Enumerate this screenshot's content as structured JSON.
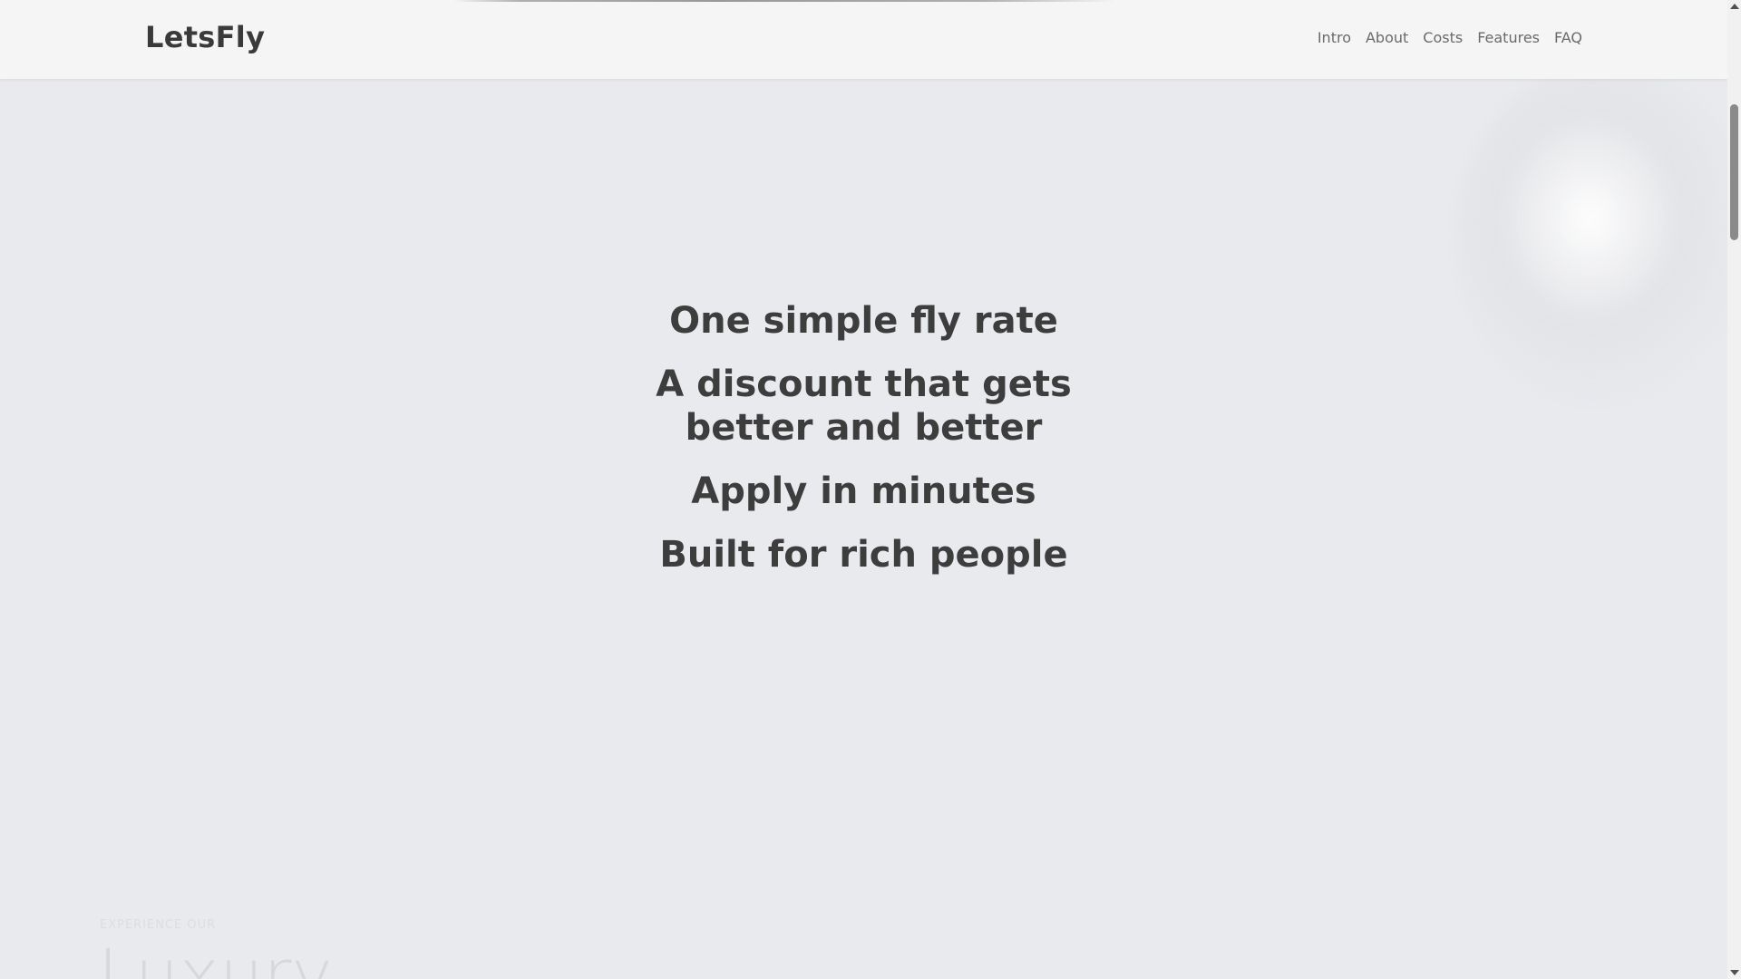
{
  "header": {
    "brand": "LetsFly",
    "nav": [
      "Intro",
      "About",
      "Costs",
      "Features",
      "FAQ"
    ]
  },
  "hero": {
    "lines": [
      "One simple fly rate",
      "A discount that gets better and better",
      "Apply in minutes",
      "Built for rich people"
    ]
  },
  "next_section": {
    "eyebrow": "EXPERIENCE OUR",
    "title": "Luxury"
  },
  "colors": {
    "header_bg": "#f5f5f5",
    "page_bg": "#e9eaee",
    "heading_text": "#3d3d3d",
    "nav_text": "#6a6a6a"
  }
}
